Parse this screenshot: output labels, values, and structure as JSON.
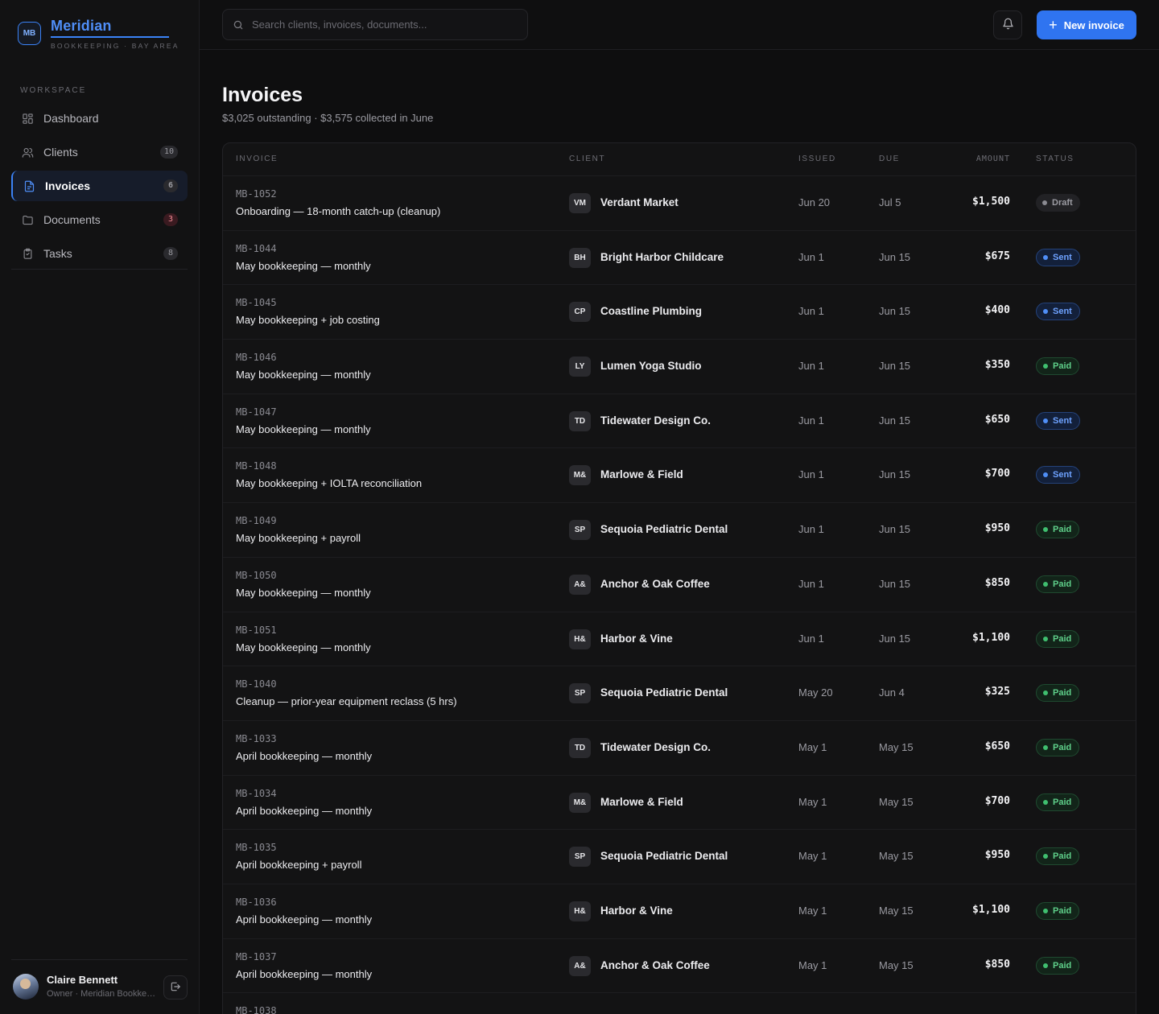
{
  "brand": {
    "logo": "MB",
    "name": "Meridian",
    "subtitle": "BOOKKEEPING · BAY AREA"
  },
  "sidebar": {
    "section_label": "WORKSPACE",
    "items": [
      {
        "label": "Dashboard",
        "icon": "grid-icon",
        "count": null,
        "active": false
      },
      {
        "label": "Clients",
        "icon": "users-icon",
        "count": "10",
        "active": false
      },
      {
        "label": "Invoices",
        "icon": "file-icon",
        "count": "6",
        "active": true
      },
      {
        "label": "Documents",
        "icon": "folder-icon",
        "count": "3",
        "active": false,
        "alert": true
      },
      {
        "label": "Tasks",
        "icon": "clipboard-icon",
        "count": "8",
        "active": false
      }
    ]
  },
  "user": {
    "name": "Claire Bennett",
    "role": "Owner · Meridian Bookkeeping"
  },
  "header": {
    "search_placeholder": "Search clients, invoices, documents...",
    "new_invoice_label": "New invoice"
  },
  "page": {
    "title": "Invoices",
    "subtitle": "$3,025 outstanding · $3,575 collected in June"
  },
  "table": {
    "columns": {
      "invoice": "INVOICE",
      "client": "CLIENT",
      "issued": "ISSUED",
      "due": "DUE",
      "amount": "AMOUNT",
      "status": "STATUS"
    },
    "rows": [
      {
        "id": "MB-1052",
        "desc": "Onboarding — 18-month catch-up (cleanup)",
        "initials": "VM",
        "client": "Verdant Market",
        "issued": "Jun 20",
        "due": "Jul 5",
        "amount": "$1,500",
        "status": "Draft"
      },
      {
        "id": "MB-1044",
        "desc": "May bookkeeping — monthly",
        "initials": "BH",
        "client": "Bright Harbor Childcare",
        "issued": "Jun 1",
        "due": "Jun 15",
        "amount": "$675",
        "status": "Sent"
      },
      {
        "id": "MB-1045",
        "desc": "May bookkeeping + job costing",
        "initials": "CP",
        "client": "Coastline Plumbing",
        "issued": "Jun 1",
        "due": "Jun 15",
        "amount": "$400",
        "status": "Sent"
      },
      {
        "id": "MB-1046",
        "desc": "May bookkeeping — monthly",
        "initials": "LY",
        "client": "Lumen Yoga Studio",
        "issued": "Jun 1",
        "due": "Jun 15",
        "amount": "$350",
        "status": "Paid"
      },
      {
        "id": "MB-1047",
        "desc": "May bookkeeping — monthly",
        "initials": "TD",
        "client": "Tidewater Design Co.",
        "issued": "Jun 1",
        "due": "Jun 15",
        "amount": "$650",
        "status": "Sent"
      },
      {
        "id": "MB-1048",
        "desc": "May bookkeeping + IOLTA reconciliation",
        "initials": "M&",
        "client": "Marlowe & Field",
        "issued": "Jun 1",
        "due": "Jun 15",
        "amount": "$700",
        "status": "Sent"
      },
      {
        "id": "MB-1049",
        "desc": "May bookkeeping + payroll",
        "initials": "SP",
        "client": "Sequoia Pediatric Dental",
        "issued": "Jun 1",
        "due": "Jun 15",
        "amount": "$950",
        "status": "Paid"
      },
      {
        "id": "MB-1050",
        "desc": "May bookkeeping — monthly",
        "initials": "A&",
        "client": "Anchor & Oak Coffee",
        "issued": "Jun 1",
        "due": "Jun 15",
        "amount": "$850",
        "status": "Paid"
      },
      {
        "id": "MB-1051",
        "desc": "May bookkeeping — monthly",
        "initials": "H&",
        "client": "Harbor & Vine",
        "issued": "Jun 1",
        "due": "Jun 15",
        "amount": "$1,100",
        "status": "Paid"
      },
      {
        "id": "MB-1040",
        "desc": "Cleanup — prior-year equipment reclass (5 hrs)",
        "initials": "SP",
        "client": "Sequoia Pediatric Dental",
        "issued": "May 20",
        "due": "Jun 4",
        "amount": "$325",
        "status": "Paid"
      },
      {
        "id": "MB-1033",
        "desc": "April bookkeeping — monthly",
        "initials": "TD",
        "client": "Tidewater Design Co.",
        "issued": "May 1",
        "due": "May 15",
        "amount": "$650",
        "status": "Paid"
      },
      {
        "id": "MB-1034",
        "desc": "April bookkeeping — monthly",
        "initials": "M&",
        "client": "Marlowe & Field",
        "issued": "May 1",
        "due": "May 15",
        "amount": "$700",
        "status": "Paid"
      },
      {
        "id": "MB-1035",
        "desc": "April bookkeeping + payroll",
        "initials": "SP",
        "client": "Sequoia Pediatric Dental",
        "issued": "May 1",
        "due": "May 15",
        "amount": "$950",
        "status": "Paid"
      },
      {
        "id": "MB-1036",
        "desc": "April bookkeeping — monthly",
        "initials": "H&",
        "client": "Harbor & Vine",
        "issued": "May 1",
        "due": "May 15",
        "amount": "$1,100",
        "status": "Paid"
      },
      {
        "id": "MB-1037",
        "desc": "April bookkeeping — monthly",
        "initials": "A&",
        "client": "Anchor & Oak Coffee",
        "issued": "May 1",
        "due": "May 15",
        "amount": "$850",
        "status": "Paid"
      },
      {
        "id": "MB-1038",
        "desc": "",
        "initials": "",
        "client": "",
        "issued": "",
        "due": "",
        "amount": "",
        "status": ""
      }
    ]
  },
  "colors": {
    "accent": "#2f74f0",
    "sent": "#4f8ef7",
    "paid": "#3fbf6f",
    "overdue": "#ef5a66"
  }
}
